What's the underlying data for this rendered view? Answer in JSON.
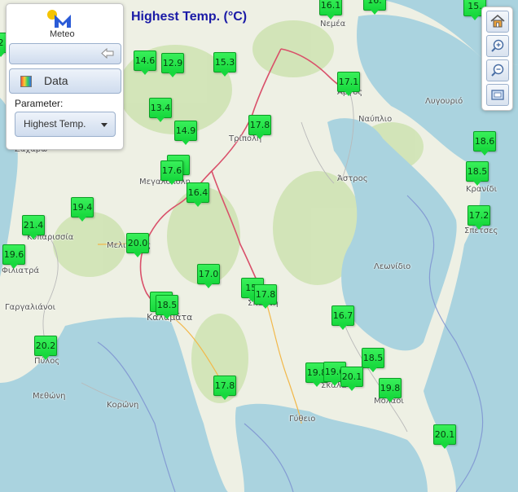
{
  "header": {
    "title": "Highest Temp. (°C)"
  },
  "logo": {
    "text": "Meteo"
  },
  "panel": {
    "data_label": "Data",
    "parameter_label": "Parameter:",
    "parameter_selected": "Highest Temp."
  },
  "toolbar": {
    "items": [
      "home-icon",
      "zoom-in-icon",
      "zoom-out-icon",
      "extent-icon"
    ]
  },
  "colors": {
    "marker": "#22e044",
    "title": "#1a1aa6",
    "road": "#d9506a",
    "sea": "#aad3df"
  },
  "places": [
    "Νεμέα",
    "Άργος",
    "Λυγουριό",
    "Ναύπλιο",
    "Τρίπολη",
    "Κρανίδι",
    "Μεγαλόπολη",
    "Άστρος",
    "Σπέτσες",
    "Κυπαρισσία",
    "Μελιγαλάς",
    "Φιλιατρά",
    "Λεωνίδιο",
    "Γαργαλιάνοι",
    "Σπάρτη",
    "Καλαμάτα",
    "Πύλος",
    "Σκάλα",
    "Μολάοι",
    "Μεθώνη",
    "Κορώνη",
    "Γύθειο",
    "Ζαχάρω"
  ],
  "stations": [
    "16.1",
    "16.",
    "15.",
    "14.6",
    "12.9",
    "15.3",
    "17.1",
    "13.4",
    "17.8",
    "14.9",
    "18.6",
    "1",
    "17.6",
    "18.5",
    "16.4",
    "19.4",
    "17.2",
    "21.4",
    "20.0",
    "19.6",
    "17.0",
    "15.",
    "17.8",
    "18",
    "18.5",
    "16.7",
    "20.2",
    "18.5",
    "19.8",
    "19.6",
    "20.1",
    "19.8",
    "17.8",
    "20.1",
    "2"
  ]
}
